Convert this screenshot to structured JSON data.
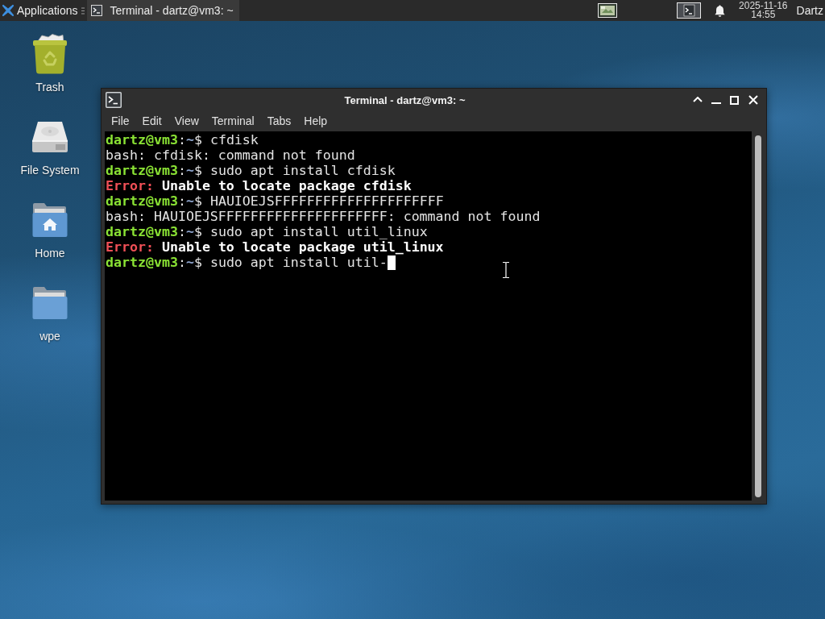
{
  "top_panel": {
    "app_menu": {
      "label": "Applications"
    },
    "tasks": [
      {
        "title": "Terminal - dartz@vm3: ~",
        "selected": true
      }
    ],
    "clock": {
      "date": "2025-11-16",
      "time": "14:55"
    },
    "user": "Dartz"
  },
  "desktop_icons": [
    {
      "kind": "trash",
      "label": "Trash"
    },
    {
      "kind": "drive",
      "label": "File System"
    },
    {
      "kind": "home",
      "label": "Home"
    },
    {
      "kind": "folder",
      "label": "wpe"
    }
  ],
  "window": {
    "title": "Terminal - dartz@vm3: ~",
    "menu": [
      "File",
      "Edit",
      "View",
      "Terminal",
      "Tabs",
      "Help"
    ],
    "terminal": {
      "lines": [
        {
          "cursor": false,
          "spans": [
            {
              "kind": "user",
              "text": "dartz@vm3"
            },
            {
              "kind": "plain",
              "text": ":"
            },
            {
              "kind": "path",
              "text": "~"
            },
            {
              "kind": "plain",
              "text": "$ cfdisk"
            }
          ]
        },
        {
          "cursor": false,
          "spans": [
            {
              "kind": "plain",
              "text": "bash: cfdisk: command not found"
            }
          ]
        },
        {
          "cursor": false,
          "spans": [
            {
              "kind": "user",
              "text": "dartz@vm3"
            },
            {
              "kind": "plain",
              "text": ":"
            },
            {
              "kind": "path",
              "text": "~"
            },
            {
              "kind": "plain",
              "text": "$ sudo apt install cfdisk"
            }
          ]
        },
        {
          "cursor": false,
          "spans": [
            {
              "kind": "error",
              "text": "Error:"
            },
            {
              "kind": "bold",
              "text": " Unable to locate package cfdisk"
            }
          ]
        },
        {
          "cursor": false,
          "spans": [
            {
              "kind": "user",
              "text": "dartz@vm3"
            },
            {
              "kind": "plain",
              "text": ":"
            },
            {
              "kind": "path",
              "text": "~"
            },
            {
              "kind": "plain",
              "text": "$ HAUIOEJSFFFFFFFFFFFFFFFFFFFFF"
            }
          ]
        },
        {
          "cursor": false,
          "spans": [
            {
              "kind": "plain",
              "text": "bash: HAUIOEJSFFFFFFFFFFFFFFFFFFFFF: command not found"
            }
          ]
        },
        {
          "cursor": false,
          "spans": [
            {
              "kind": "user",
              "text": "dartz@vm3"
            },
            {
              "kind": "plain",
              "text": ":"
            },
            {
              "kind": "path",
              "text": "~"
            },
            {
              "kind": "plain",
              "text": "$ sudo apt install util_linux"
            }
          ]
        },
        {
          "cursor": false,
          "spans": [
            {
              "kind": "error",
              "text": "Error:"
            },
            {
              "kind": "bold",
              "text": " Unable to locate package util_linux"
            }
          ]
        },
        {
          "cursor": true,
          "spans": [
            {
              "kind": "user",
              "text": "dartz@vm3"
            },
            {
              "kind": "plain",
              "text": ":"
            },
            {
              "kind": "path",
              "text": "~"
            },
            {
              "kind": "plain",
              "text": "$ sudo apt install util-"
            }
          ]
        }
      ]
    }
  }
}
